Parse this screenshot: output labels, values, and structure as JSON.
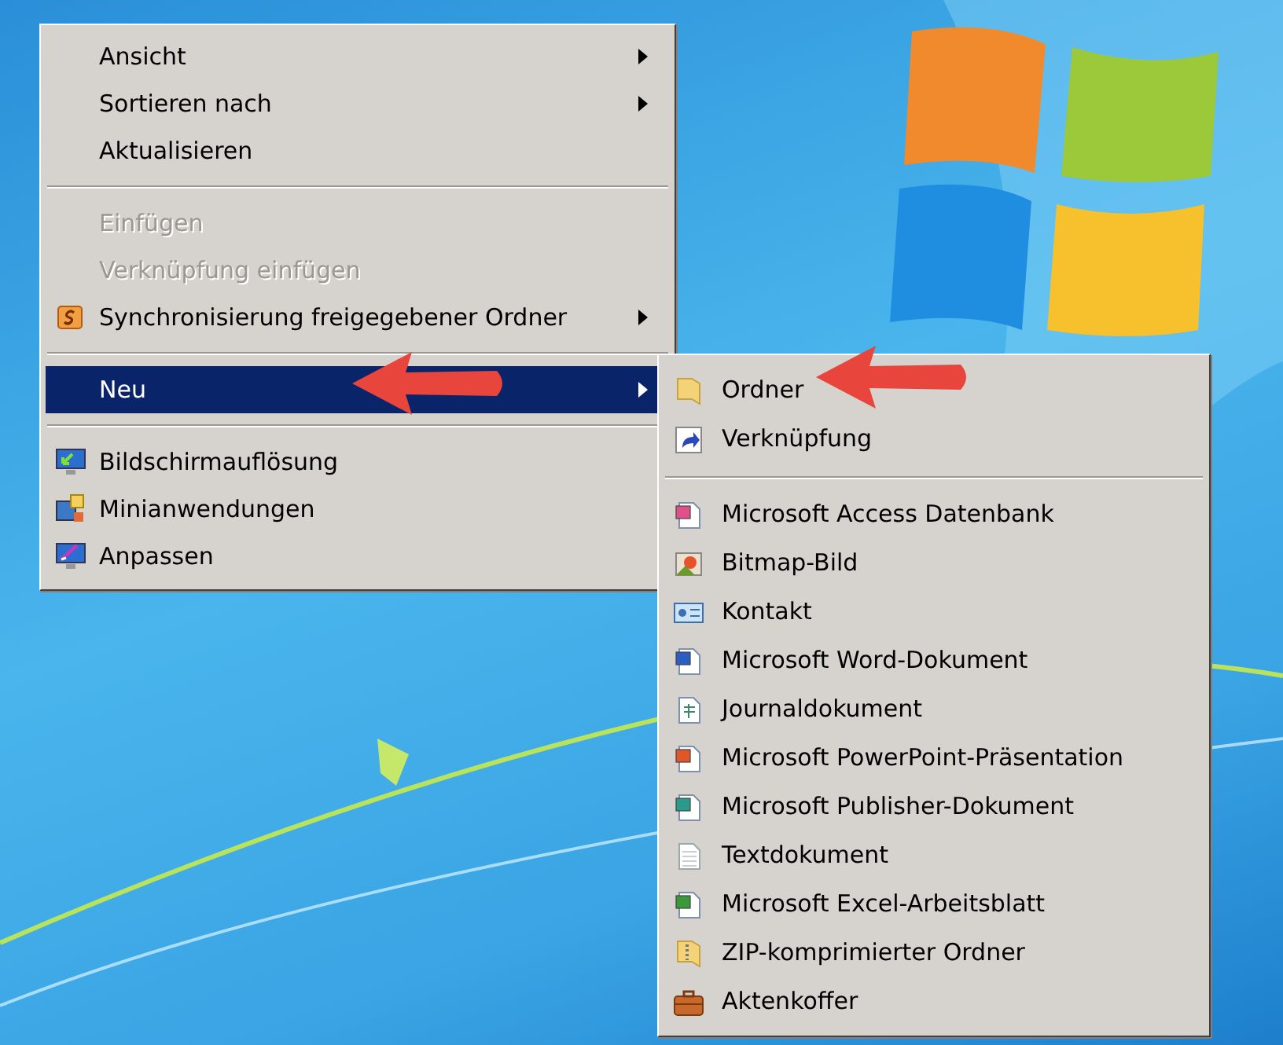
{
  "context_menu": {
    "items": [
      {
        "kind": "item",
        "label": "Ansicht",
        "submenu": true,
        "disabled": false,
        "selected": false
      },
      {
        "kind": "item",
        "label": "Sortieren nach",
        "submenu": true,
        "disabled": false,
        "selected": false
      },
      {
        "kind": "item",
        "label": "Aktualisieren",
        "submenu": false,
        "disabled": false,
        "selected": false
      },
      {
        "kind": "separator"
      },
      {
        "kind": "item",
        "label": "Einfügen",
        "submenu": false,
        "disabled": true,
        "selected": false
      },
      {
        "kind": "item",
        "label": "Verknüpfung einfügen",
        "submenu": false,
        "disabled": true,
        "selected": false
      },
      {
        "kind": "item",
        "label": "Synchronisierung freigegebener Ordner",
        "submenu": true,
        "disabled": false,
        "selected": false
      },
      {
        "kind": "separator"
      },
      {
        "kind": "item",
        "label": "Neu",
        "submenu": true,
        "disabled": false,
        "selected": true
      },
      {
        "kind": "separator"
      },
      {
        "kind": "item",
        "label": "Bildschirmauflösung",
        "submenu": false,
        "disabled": false,
        "selected": false
      },
      {
        "kind": "item",
        "label": "Minianwendungen",
        "submenu": false,
        "disabled": false,
        "selected": false
      },
      {
        "kind": "item",
        "label": "Anpassen",
        "submenu": false,
        "disabled": false,
        "selected": false
      }
    ]
  },
  "new_submenu": {
    "items": [
      {
        "kind": "item",
        "label": "Ordner",
        "selected": false
      },
      {
        "kind": "item",
        "label": "Verknüpfung",
        "selected": false
      },
      {
        "kind": "separator"
      },
      {
        "kind": "item",
        "label": "Microsoft Access Datenbank",
        "selected": false
      },
      {
        "kind": "item",
        "label": "Bitmap-Bild",
        "selected": false
      },
      {
        "kind": "item",
        "label": "Kontakt",
        "selected": false
      },
      {
        "kind": "item",
        "label": "Microsoft Word-Dokument",
        "selected": false
      },
      {
        "kind": "item",
        "label": "Journaldokument",
        "selected": false
      },
      {
        "kind": "item",
        "label": "Microsoft PowerPoint-Präsentation",
        "selected": false
      },
      {
        "kind": "item",
        "label": "Microsoft Publisher-Dokument",
        "selected": false
      },
      {
        "kind": "item",
        "label": "Textdokument",
        "selected": false
      },
      {
        "kind": "item",
        "label": "Microsoft Excel-Arbeitsblatt",
        "selected": false
      },
      {
        "kind": "item",
        "label": "ZIP-komprimierter Ordner",
        "selected": false
      },
      {
        "kind": "item",
        "label": "Aktenkoffer",
        "selected": false
      }
    ]
  }
}
